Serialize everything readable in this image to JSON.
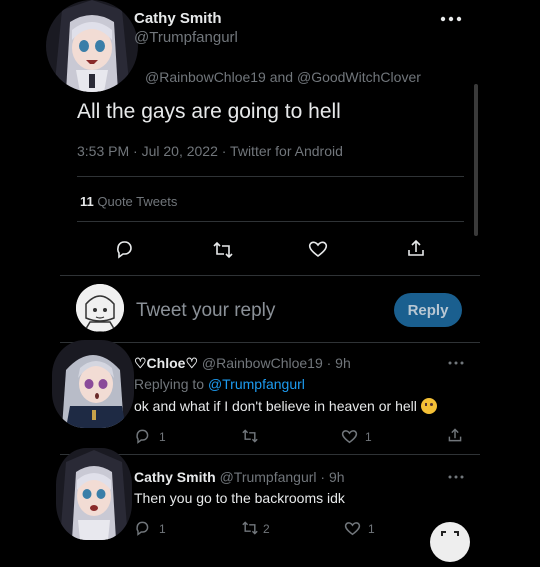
{
  "main_tweet": {
    "author_name": "Cathy Smith",
    "author_handle": "@Trumpfangurl",
    "replying_to": "@RainbowChloe19 and @GoodWitchClover",
    "text": "All the gays are going to hell",
    "meta": "3:53 PM · Jul 20, 2022 · Twitter for Android",
    "quote_count": "11",
    "quote_label": "Quote Tweets"
  },
  "reply_box": {
    "placeholder": "Tweet your reply",
    "button_label": "Reply"
  },
  "replies": [
    {
      "author_name": "♡Chloe♡",
      "author_handle": "@RainbowChloe19",
      "time": "· 9h",
      "replying_label": "Replying to",
      "replying_handle": "@Trumpfangurl",
      "text": "ok and what if I don't believe in heaven or hell",
      "reply_count": "1",
      "retweet_count": "",
      "like_count": "1"
    },
    {
      "author_name": "Cathy Smith",
      "author_handle": "@Trumpfangurl",
      "time": "· 9h",
      "text": "Then you go to the backrooms idk",
      "reply_count": "1",
      "retweet_count": "2",
      "like_count": "1"
    }
  ],
  "colors": {
    "background": "#000000",
    "text": "#e7e9ea",
    "muted": "#71767b",
    "link": "#1d9bf0",
    "reply_button": "#1a5f8f"
  }
}
